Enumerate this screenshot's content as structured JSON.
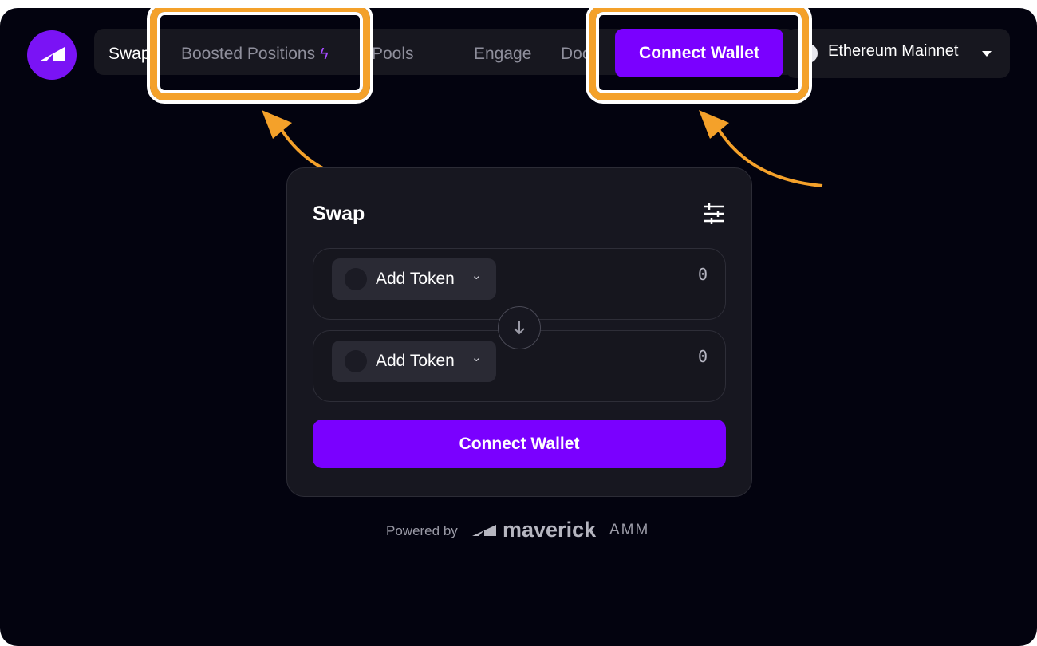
{
  "nav": {
    "items": [
      {
        "label": "Swap"
      },
      {
        "label": "Boosted Positions"
      },
      {
        "label": "Pools"
      },
      {
        "label": "Engage"
      },
      {
        "label": "Doc"
      }
    ],
    "connect_wallet_label": "Connect Wallet",
    "network_label": "Ethereum Mainnet"
  },
  "swap": {
    "title": "Swap",
    "from": {
      "token_label": "Add Token",
      "amount": "0"
    },
    "to": {
      "token_label": "Add Token",
      "amount": "0"
    },
    "connect_wallet_label": "Connect Wallet"
  },
  "footer": {
    "powered_by": "Powered by",
    "brand": "maverick",
    "amm": "AMM"
  },
  "colors": {
    "accent": "#7a00ff",
    "highlight": "#f4a12a",
    "background": "#03030f"
  },
  "icons": [
    "maverick-logo-icon",
    "bolt-icon",
    "ethereum-icon",
    "caret-down-icon",
    "settings-sliders-icon",
    "chevron-down-icon",
    "arrow-down-icon"
  ]
}
